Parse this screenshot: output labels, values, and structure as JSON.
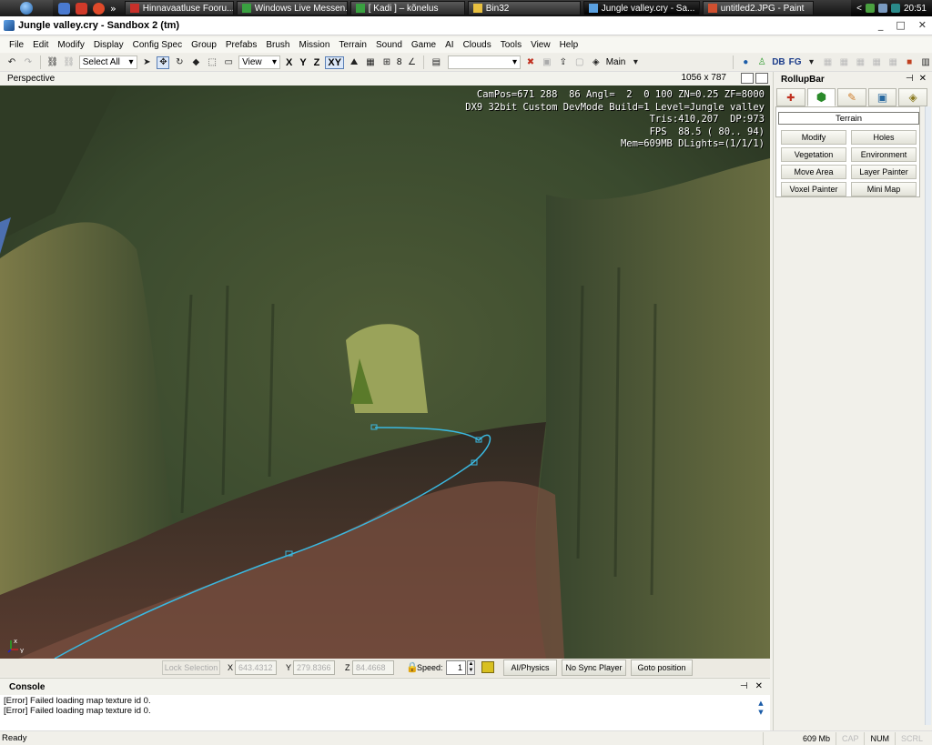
{
  "taskbar": {
    "tasks": [
      {
        "label": "Hinnavaatluse Fooru..."
      },
      {
        "label": "Windows Live Messen..."
      },
      {
        "label": "[ Kadi ] – kõnelus"
      },
      {
        "label": "Bin32"
      },
      {
        "label": "Jungle valley.cry - Sa..."
      },
      {
        "label": "untitled2.JPG - Paint"
      }
    ],
    "overflow": "»",
    "tray_arrow": "<",
    "clock": "20:51"
  },
  "window": {
    "title": "Jungle valley.cry - Sandbox 2 (tm)",
    "controls": [
      "_",
      "□",
      "✕"
    ]
  },
  "menu": [
    "File",
    "Edit",
    "Modify",
    "Display",
    "Config Spec",
    "Group",
    "Prefabs",
    "Brush",
    "Mission",
    "Terrain",
    "Sound",
    "Game",
    "AI",
    "Clouds",
    "Tools",
    "View",
    "Help"
  ],
  "toolbar": {
    "selection_combo": "Select All",
    "view_combo": "View",
    "axes": [
      "X",
      "Y",
      "Z",
      "XY"
    ],
    "grid_value": "8",
    "layer_combo": "Main",
    "db_label": "DB",
    "fg_label": "FG"
  },
  "viewport": {
    "title": "Perspective",
    "resolution": "1056 x 787",
    "info_lines": [
      "CamPos=671 288  86 Angl=  2  0 100 ZN=0.25 ZF=8000",
      "DX9 32bit Custom DevMode Build=1 Level=Jungle valley",
      "Tris:410,207  DP:973",
      "FPS  88.5 ( 80.. 94)",
      "Mem=609MB DLights=(1/1/1)"
    ],
    "gizmo_x": "x",
    "gizmo_y": "y"
  },
  "bottom_bar": {
    "lock_label": "Lock Selection",
    "x_label": "X",
    "x_value": "643.4312",
    "y_label": "Y",
    "y_value": "279.8366",
    "z_label": "Z",
    "z_value": "84.4668",
    "speed_label": "Speed:",
    "speed_value": "1",
    "ai_physics": "AI/Physics",
    "no_sync": "No Sync Player",
    "goto": "Goto position"
  },
  "console": {
    "title": "Console",
    "lines": [
      "[Error] Failed loading map texture id 0.",
      "[Error] Failed loading map texture id 0."
    ]
  },
  "statusbar": {
    "text": "Ready",
    "memory": "609 Mb",
    "cap": "CAP",
    "num": "NUM",
    "scrl": "SCRL"
  },
  "rollup": {
    "title": "RollupBar",
    "panel_title": "Terrain",
    "buttons": [
      "Modify",
      "Holes",
      "Vegetation",
      "Environment",
      "Move Area",
      "Layer Painter",
      "Voxel Painter",
      "Mini Map"
    ]
  },
  "colors": {
    "path_line": "#3ab8e0",
    "info_text": "#ffffff"
  }
}
